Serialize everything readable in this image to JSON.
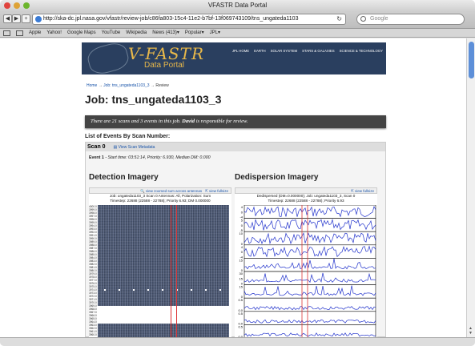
{
  "window": {
    "title": "VFASTR Data Portal"
  },
  "toolbar": {
    "url": "http://ska-dc.jpl.nasa.gov/vfastr/review-job/c86fa803-15c4-11e2-b7bf-13f069743109/tns_ungateda1103",
    "search_placeholder": "Google"
  },
  "bookmarks": [
    "Apple",
    "Yahoo!",
    "Google Maps",
    "YouTube",
    "Wikipedia",
    "News (413)▾",
    "Popular▾",
    "JPL▾"
  ],
  "banner": {
    "logo_title": "V-FASTR",
    "logo_sub": "Data Portal",
    "nav": [
      "JPL HOME",
      "EARTH",
      "SOLAR SYSTEM",
      "STARS & GALAXIES",
      "SCIENCE & TECHNOLOGY"
    ]
  },
  "breadcrumb": {
    "home": "Home",
    "sep1": " → ",
    "job": "Job: tns_ungateda1103_3",
    "sep2": " → ",
    "current": "Review"
  },
  "page": {
    "title": "Job: tns_ungateda1103_3",
    "notice_a": "There are 21 scans and 3 events in this job. ",
    "notice_user": "David",
    "notice_b": " is responsible for review.",
    "list_heading": "List of Events By Scan Number:"
  },
  "scan": {
    "label": "Scan 0",
    "meta_link": "View Scan Metadata",
    "event_label": "Event 1",
    "event_detail": " - Start time: 03:51:14,  Priority: 6.930,  Median DM: 0.000"
  },
  "detection": {
    "heading": "Detection Imagery",
    "link_zoom": "view zoomed sum across antennas",
    "link_full": "view fullsize",
    "caption_1": "Job: ungateda1103_3    Scan 0    Antennas: All, Polarization: Sum",
    "caption_2": "Timestep: 22688 (22588 - 22788); Priority 6.93; DM 0.000000",
    "axis_labels": [
      "4000.0",
      "3999.0",
      "3998.0",
      "3997.0",
      "3996.0",
      "3995.0",
      "3994.0",
      "3993.0",
      "3992.0",
      "3991.0",
      "3990.0",
      "3989.0",
      "3988.0",
      "3987.0",
      "3986.0",
      "3985.0",
      "3984.0",
      "3983.0",
      "3982.0",
      "3981.0",
      "3980.0",
      "3979.0",
      "3978.0",
      "3977.0",
      "3976.0",
      "3975.0",
      "3974.0",
      "3973.0",
      "3972.0",
      "3971.0",
      "3970.0",
      "3969.0",
      "3968.0",
      "3967.0",
      "3966.0",
      "3965.0",
      "3964.0",
      "3963.0",
      "3962.0",
      "3961.0",
      "3960.0"
    ]
  },
  "dedispersion": {
    "heading": "Dedispersion Imagery",
    "link_full": "view fullsize",
    "caption_1": "Dedispersed (DM=0.000000); Job: ungateda1103_3, Scan 0",
    "caption_2": "Timestep: 22688 (22588 - 22788); Priority 6.93",
    "panel_ticks": [
      [
        "4",
        "0",
        "-4"
      ],
      [
        "5",
        "0",
        "-5"
      ],
      [
        "10",
        "0"
      ],
      [
        "4",
        "0",
        "-4"
      ],
      [
        "15",
        "0"
      ],
      [
        "30",
        "15",
        "0"
      ],
      [
        "15",
        "0"
      ],
      [
        "0.5",
        "0.0"
      ],
      [
        "0.5",
        "0.0"
      ],
      [
        "0.5",
        "0.0"
      ]
    ]
  }
}
